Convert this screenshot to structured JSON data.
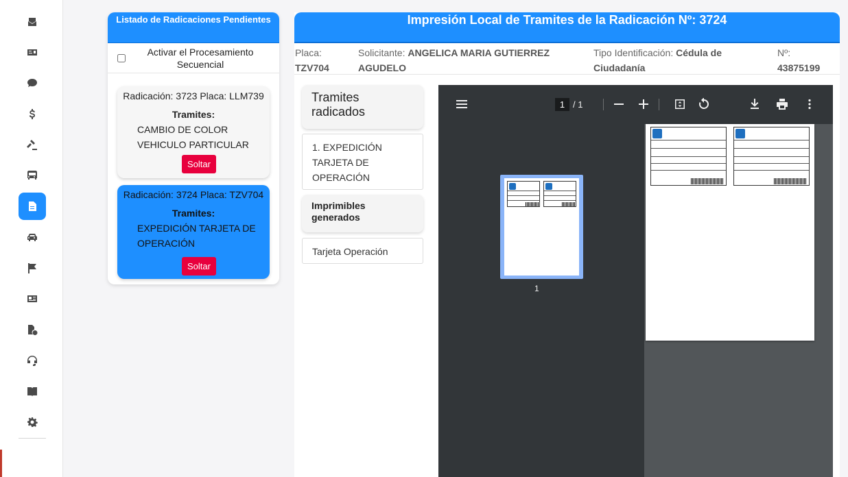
{
  "sidebar": {
    "icons": [
      "envelope-icon",
      "money-card-icon",
      "chat-dollar-icon",
      "dollar-icon",
      "gavel-icon",
      "bus-icon",
      "document-icon",
      "car-icon",
      "flag-icon",
      "id-card-icon",
      "file-info-icon",
      "headset-icon",
      "book-icon",
      "gear-icon"
    ],
    "active_index": 6,
    "accent": "#1e8fff"
  },
  "pending": {
    "title": "Listado de Radicaciones Pendientes",
    "sequential_label": "Activar el Procesamiento Secuencial",
    "cards": [
      {
        "radicacion": "Radicación: 3723 Placa: LLM739",
        "tramites_label": "Tramites:",
        "items": [
          "CAMBIO DE COLOR",
          "VEHICULO PARTICULAR"
        ],
        "button": "Soltar"
      },
      {
        "radicacion": "Radicación: 3724 Placa: TZV704",
        "tramites_label": "Tramites:",
        "items": [
          "EXPEDICIÓN TARJETA DE",
          "OPERACIÓN"
        ],
        "button": "Soltar"
      }
    ]
  },
  "main": {
    "title": "Impresión Local de Tramites de la Radicación Nº: 3724",
    "placa_label": "Placa:",
    "placa_value": "TZV704",
    "solicitante_label": "Solicitante:",
    "solicitante_value_1": "ANGELICA MARIA GUTIERREZ",
    "solicitante_value_2": "AGUDELO",
    "tipo_label": "Tipo Identificación:",
    "tipo_value_1": "Cédula de",
    "tipo_value_2": "Ciudadanía",
    "numero_label": "Nº:",
    "numero_value": "43875199",
    "tramites_title": "Tramites radicados",
    "tramites_items": [
      "1. EXPEDICIÓN TARJETA DE OPERACIÓN"
    ],
    "imprimibles_title": "Imprimibles generados",
    "imprimibles_items": [
      "Tarjeta Operación"
    ]
  },
  "pdf_viewer": {
    "current_page": "1",
    "total_pages": "/ 1",
    "thumbnail_label": "1",
    "toolbar_icons": [
      "menu-icon",
      "zoom-out-icon",
      "zoom-in-icon",
      "fit-page-icon",
      "rotate-icon",
      "download-icon",
      "print-icon",
      "more-icon"
    ]
  }
}
